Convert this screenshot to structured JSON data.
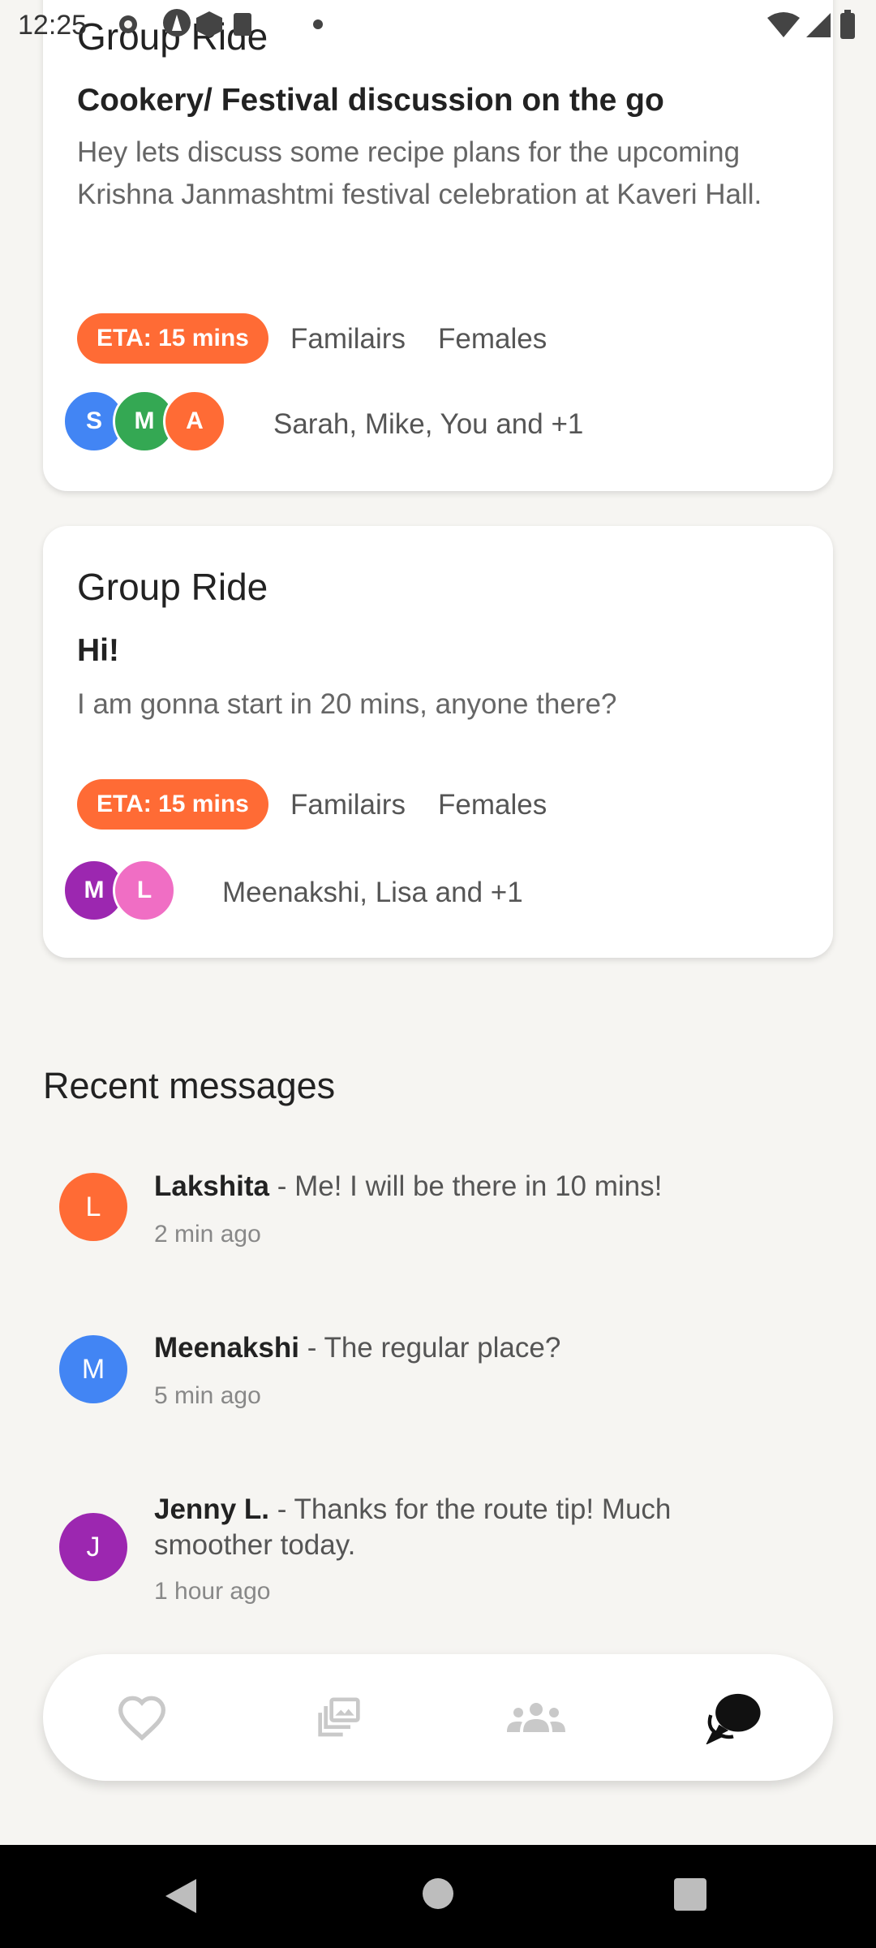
{
  "status_bar": {
    "time": "12:25"
  },
  "cards": [
    {
      "title": "Group Ride",
      "subtitle": "Cookery/ Festival discussion on the go",
      "description": "Hey lets discuss some recipe plans for the upcoming Krishna Janmashtmi festival celebration at Kaveri Hall.",
      "eta": "ETA: 15 mins",
      "tags": [
        "Familairs",
        "Females"
      ],
      "avatars": [
        {
          "letter": "S",
          "color": "#4285f4"
        },
        {
          "letter": "M",
          "color": "#34a853"
        },
        {
          "letter": "A",
          "color": "#ff6b35"
        }
      ],
      "participants": "Sarah, Mike, You and +1"
    },
    {
      "title": "Group Ride",
      "subtitle": "Hi!",
      "description": "I am gonna start in 20 mins, anyone there?",
      "eta": "ETA: 15 mins",
      "tags": [
        "Familairs",
        "Females"
      ],
      "avatars": [
        {
          "letter": "M",
          "color": "#9c27b0"
        },
        {
          "letter": "L",
          "color": "#f06ec4"
        }
      ],
      "participants": "Meenakshi, Lisa and +1"
    }
  ],
  "recent": {
    "title": "Recent messages",
    "messages": [
      {
        "initial": "L",
        "color": "#ff6b35",
        "name": "Lakshita",
        "text": " - Me! I will be there in 10 mins!",
        "time": "2 min ago"
      },
      {
        "initial": "M",
        "color": "#4285f4",
        "name": "Meenakshi",
        "text": " - The regular place?",
        "time": "5 min ago"
      },
      {
        "initial": "J",
        "color": "#9c27b0",
        "name": "Jenny L.",
        "text": " - Thanks for the route tip! Much smoother today.",
        "time": "1 hour ago"
      }
    ]
  },
  "tab_bar": {
    "tabs": [
      {
        "icon": "heart-icon",
        "active": false
      },
      {
        "icon": "gallery-icon",
        "active": false
      },
      {
        "icon": "group-icon",
        "active": false
      },
      {
        "icon": "chat-icon",
        "active": true
      }
    ]
  },
  "colors": {
    "accent": "#ff6b35",
    "background": "#f6f5f2"
  }
}
